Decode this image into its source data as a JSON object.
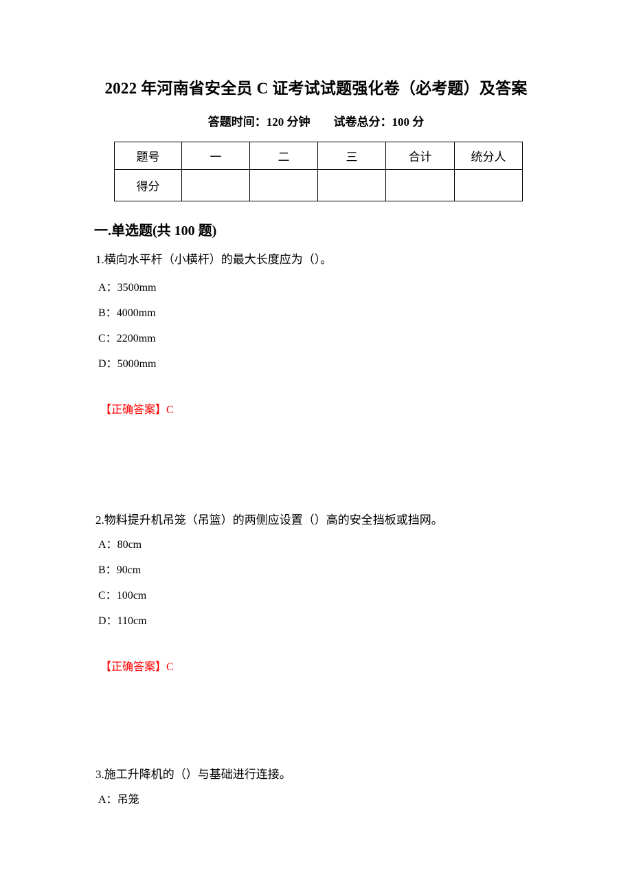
{
  "document": {
    "title": "2022 年河南省安全员 C 证考试试题强化卷（必考题）及答案",
    "subtitle": "答题时间：120 分钟　　试卷总分：100 分",
    "answer_color": "#ff0000"
  },
  "score_table": {
    "header_row": [
      "题号",
      "一",
      "二",
      "三",
      "合计",
      "统分人"
    ],
    "body_row": [
      "得分",
      "",
      "",
      "",
      "",
      ""
    ]
  },
  "sections": [
    {
      "heading": "一.单选题(共 100 题)",
      "questions": [
        {
          "stem": "1.横向水平杆（小横杆）的最大长度应为（）。",
          "options": [
            {
              "letter": "A：",
              "text": "3500mm"
            },
            {
              "letter": "B：",
              "text": "4000mm"
            },
            {
              "letter": "C：",
              "text": "2200mm"
            },
            {
              "letter": "D：",
              "text": "5000mm"
            }
          ],
          "answer_label": "【正确答案】",
          "answer_value": "C"
        },
        {
          "stem": "2.物料提升机吊笼（吊篮）的两侧应设置（）高的安全挡板或挡网。",
          "options": [
            {
              "letter": "A：",
              "text": "80cm"
            },
            {
              "letter": "B：",
              "text": "90cm"
            },
            {
              "letter": "C：",
              "text": "100cm"
            },
            {
              "letter": "D：",
              "text": "110cm"
            }
          ],
          "answer_label": "【正确答案】",
          "answer_value": "C"
        },
        {
          "stem": "3.施工升降机的（）与基础进行连接。",
          "options": [
            {
              "letter": "A：",
              "text": "吊笼"
            }
          ],
          "answer_label": "",
          "answer_value": ""
        }
      ]
    }
  ]
}
